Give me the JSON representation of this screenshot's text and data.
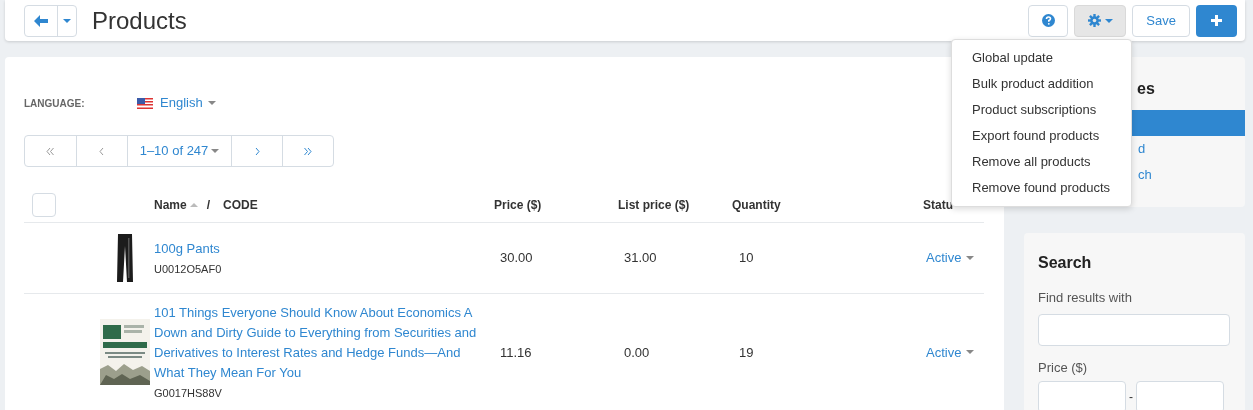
{
  "header": {
    "title": "Products",
    "save_label": "Save"
  },
  "tools_menu": {
    "open": true,
    "items": [
      "Global update",
      "Bulk product addition",
      "Product subscriptions",
      "Export found products",
      "Remove all products",
      "Remove found products"
    ]
  },
  "language": {
    "label": "LANGUAGE:",
    "value": "English"
  },
  "pagination": {
    "range": "1–10 of 247"
  },
  "table": {
    "select_all_checked": false,
    "columns": [
      {
        "kind": "name",
        "label": "Name",
        "sep": "/",
        "label2": "CODE"
      },
      {
        "kind": "plain",
        "label": "Price ($)"
      },
      {
        "kind": "plain",
        "label": "List price ($)"
      },
      {
        "kind": "plain",
        "label": "Quantity"
      },
      {
        "kind": "status",
        "label": "Statu"
      }
    ],
    "rows": [
      {
        "kind": "pants",
        "name": "100g Pants",
        "code": "U0012O5AF0",
        "price": "30.00",
        "list_price": "31.00",
        "quantity": "10",
        "status": "Active"
      },
      {
        "kind": "book",
        "name": "101 Things Everyone Should Know About Economics A Down and Dirty Guide to Everything from Securities and Derivatives to Interest Rates and Hedge Funds—And What They Mean For You",
        "code": "G0017HS88V",
        "price": "11.16",
        "list_price": "0.00",
        "quantity": "19",
        "status": "Active"
      }
    ]
  },
  "saved_searches": {
    "title": "es",
    "items": [
      {
        "selected": true
      },
      {
        "label": "d",
        "selected": false
      },
      {
        "label": "ch",
        "selected": false
      }
    ]
  },
  "search": {
    "title": "Search",
    "find_label": "Find results with",
    "price_label": "Price ($)",
    "range_sep": "-"
  }
}
